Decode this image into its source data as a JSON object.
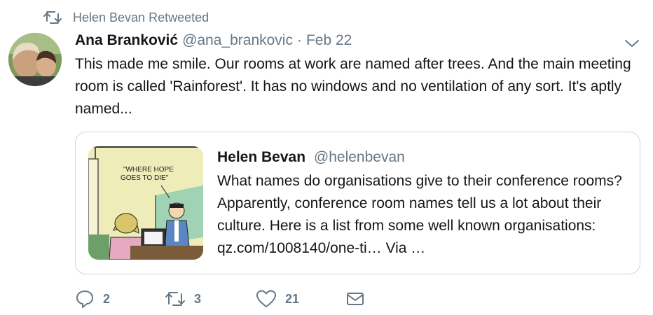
{
  "retweet_bar": {
    "icon": "retweet-icon",
    "text": "Helen Bevan Retweeted"
  },
  "tweet": {
    "author_name": "Ana Branković",
    "author_handle": "@ana_brankovic",
    "separator": "·",
    "date": "Feb 22",
    "text": "This made me smile. Our rooms at work are named after trees. And the main meeting room is called 'Rainforest'. It has no windows and no ventilation of any sort. It's aptly named..."
  },
  "quoted_tweet": {
    "author_name": "Helen Bevan",
    "author_handle": "@helenbevan",
    "text": "What names do organisations give to their conference rooms?  Apparently, conference room names tell us a lot about their culture. Here is a list from some well known organisations: qz.com/1008140/one-ti… Via …",
    "image_caption": "\"WHERE HOPE GOES TO DIE\""
  },
  "actions": {
    "reply_count": "2",
    "retweet_count": "3",
    "like_count": "21"
  },
  "colors": {
    "secondary_text": "#657786",
    "primary_text": "#14171a",
    "card_border": "#ccd6dd"
  }
}
